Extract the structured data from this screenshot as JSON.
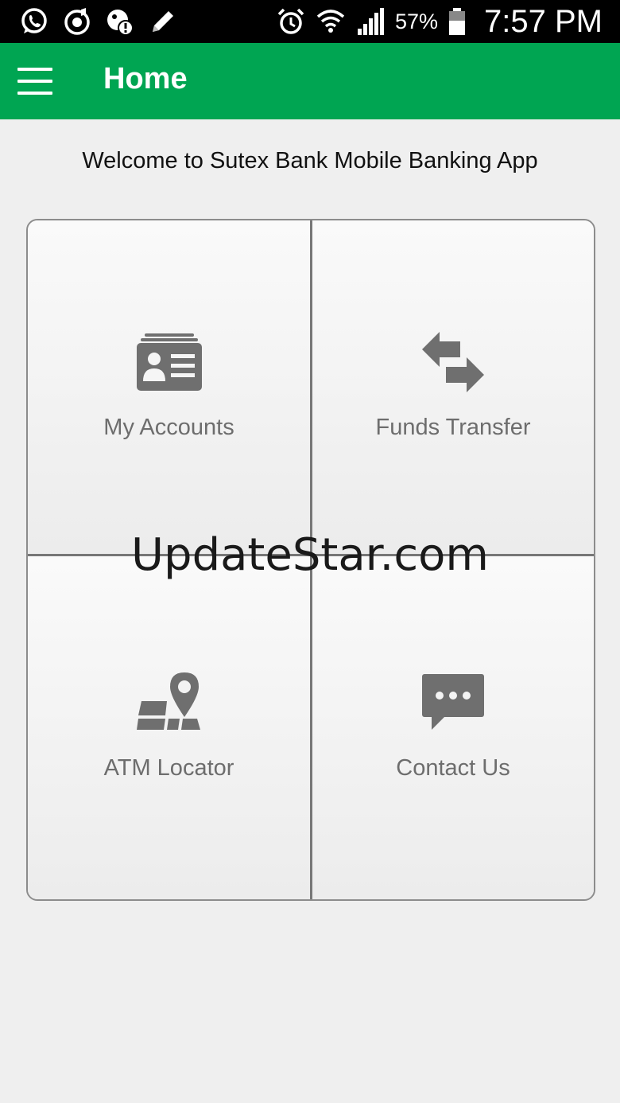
{
  "status_bar": {
    "left_icons": [
      "whatsapp-icon",
      "music-icon",
      "sync-alert-icon",
      "pencil-icon"
    ],
    "right_icons": [
      "alarm-icon",
      "wifi-icon",
      "signal-icon",
      "battery-icon"
    ],
    "battery_percent": "57%",
    "time": "7:57 PM"
  },
  "app_bar": {
    "title": "Home",
    "color": "#00a552",
    "menu_icon": "hamburger-menu-icon"
  },
  "welcome_text": "Welcome to Sutex Bank Mobile Banking App",
  "tiles": [
    {
      "label": "My Accounts",
      "icon": "id-card-icon"
    },
    {
      "label": "Funds Transfer",
      "icon": "transfer-arrows-icon"
    },
    {
      "label": "ATM Locator",
      "icon": "map-pin-icon"
    },
    {
      "label": "Contact Us",
      "icon": "chat-bubble-icon"
    }
  ],
  "watermark": "UpdateStar.com"
}
